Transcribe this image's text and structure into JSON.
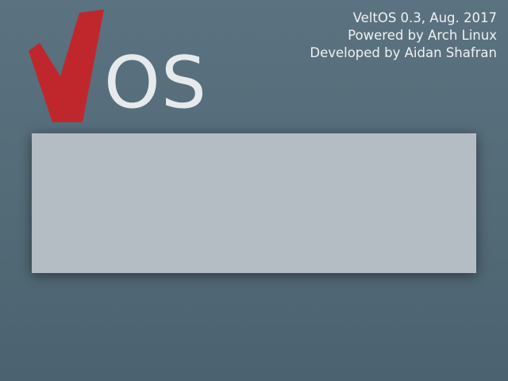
{
  "logo": {
    "text": "OS",
    "mark_color": "#c0272d",
    "text_color": "#e6eaed"
  },
  "info": {
    "version_line": "VeltOS 0.3, Aug. 2017",
    "powered_line": "Powered by Arch Linux",
    "developer_line": "Developed by Aidan Shafran"
  },
  "colors": {
    "background": "#566d7a",
    "panel": "#b5bdc4"
  }
}
